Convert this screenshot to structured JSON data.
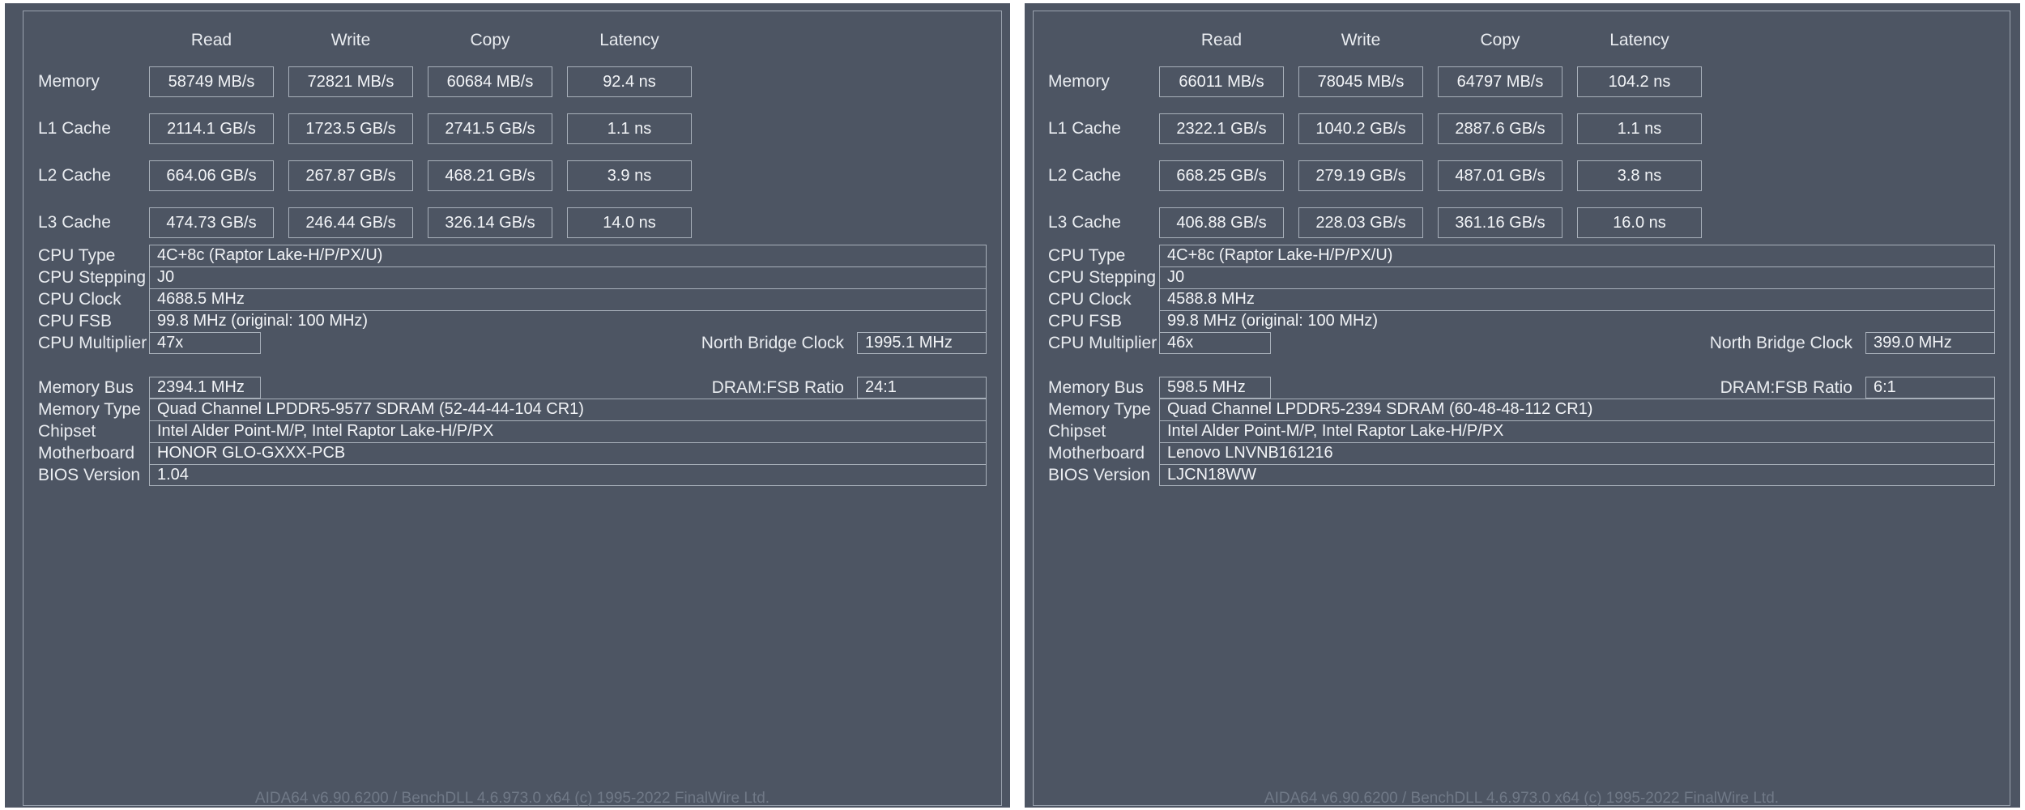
{
  "app": {
    "footer_text": "AIDA64 v6.90.6200 / BenchDLL 4.6.973.0 x64  (c) 1995-2022 FinalWire Ltd."
  },
  "colors": {
    "panel_bg": "#4d5563",
    "page_bg": "#ffffff",
    "border": "#a8b0ba",
    "text": "#f2f4f7",
    "label": "#e9ecf0",
    "footer_text": "#707987"
  },
  "columns": [
    "Read",
    "Write",
    "Copy",
    "Latency"
  ],
  "row_labels": [
    "Memory",
    "L1 Cache",
    "L2 Cache",
    "L3 Cache"
  ],
  "left_panel": {
    "bench": {
      "headers": {
        "read": "Read",
        "write": "Write",
        "copy": "Copy",
        "latency": "Latency"
      },
      "rows": [
        {
          "label": "Memory",
          "read": "58749 MB/s",
          "write": "72821 MB/s",
          "copy": "60684 MB/s",
          "latency": "92.4 ns"
        },
        {
          "label": "L1 Cache",
          "read": "2114.1 GB/s",
          "write": "1723.5 GB/s",
          "copy": "2741.5 GB/s",
          "latency": "1.1 ns"
        },
        {
          "label": "L2 Cache",
          "read": "664.06 GB/s",
          "write": "267.87 GB/s",
          "copy": "468.21 GB/s",
          "latency": "3.9 ns"
        },
        {
          "label": "L3 Cache",
          "read": "474.73 GB/s",
          "write": "246.44 GB/s",
          "copy": "326.14 GB/s",
          "latency": "14.0 ns"
        }
      ]
    },
    "cpu": {
      "type_label": "CPU Type",
      "type_value": "4C+8c   (Raptor Lake-H/P/PX/U)",
      "stepping_label": "CPU Stepping",
      "stepping_value": "J0",
      "clock_label": "CPU Clock",
      "clock_value": "4688.5 MHz",
      "fsb_label": "CPU FSB",
      "fsb_value": "99.8 MHz  (original: 100 MHz)",
      "multiplier_label": "CPU Multiplier",
      "multiplier_value": "47x",
      "nb_clock_label": "North Bridge Clock",
      "nb_clock_value": "1995.1 MHz"
    },
    "memory": {
      "bus_label": "Memory Bus",
      "bus_value": "2394.1 MHz",
      "ratio_label": "DRAM:FSB Ratio",
      "ratio_value": "24:1",
      "type_label": "Memory Type",
      "type_value": "Quad Channel LPDDR5-9577 SDRAM  (52-44-44-104 CR1)",
      "chipset_label": "Chipset",
      "chipset_value": "Intel Alder Point-M/P, Intel Raptor Lake-H/P/PX",
      "motherboard_label": "Motherboard",
      "motherboard_value": "HONOR GLO-GXXX-PCB",
      "bios_label": "BIOS Version",
      "bios_value": "1.04"
    },
    "footer": "AIDA64 v6.90.6200 / BenchDLL 4.6.973.0 x64  (c) 1995-2022 FinalWire Ltd."
  },
  "right_panel": {
    "bench": {
      "headers": {
        "read": "Read",
        "write": "Write",
        "copy": "Copy",
        "latency": "Latency"
      },
      "rows": [
        {
          "label": "Memory",
          "read": "66011 MB/s",
          "write": "78045 MB/s",
          "copy": "64797 MB/s",
          "latency": "104.2 ns"
        },
        {
          "label": "L1 Cache",
          "read": "2322.1 GB/s",
          "write": "1040.2 GB/s",
          "copy": "2887.6 GB/s",
          "latency": "1.1 ns"
        },
        {
          "label": "L2 Cache",
          "read": "668.25 GB/s",
          "write": "279.19 GB/s",
          "copy": "487.01 GB/s",
          "latency": "3.8 ns"
        },
        {
          "label": "L3 Cache",
          "read": "406.88 GB/s",
          "write": "228.03 GB/s",
          "copy": "361.16 GB/s",
          "latency": "16.0 ns"
        }
      ]
    },
    "cpu": {
      "type_label": "CPU Type",
      "type_value": "4C+8c   (Raptor Lake-H/P/PX/U)",
      "stepping_label": "CPU Stepping",
      "stepping_value": "J0",
      "clock_label": "CPU Clock",
      "clock_value": "4588.8 MHz",
      "fsb_label": "CPU FSB",
      "fsb_value": "99.8 MHz  (original: 100 MHz)",
      "multiplier_label": "CPU Multiplier",
      "multiplier_value": "46x",
      "nb_clock_label": "North Bridge Clock",
      "nb_clock_value": "399.0 MHz"
    },
    "memory": {
      "bus_label": "Memory Bus",
      "bus_value": "598.5 MHz",
      "ratio_label": "DRAM:FSB Ratio",
      "ratio_value": "6:1",
      "type_label": "Memory Type",
      "type_value": "Quad Channel LPDDR5-2394 SDRAM  (60-48-48-112 CR1)",
      "chipset_label": "Chipset",
      "chipset_value": "Intel Alder Point-M/P, Intel Raptor Lake-H/P/PX",
      "motherboard_label": "Motherboard",
      "motherboard_value": "Lenovo LNVNB161216",
      "bios_label": "BIOS Version",
      "bios_value": "LJCN18WW"
    },
    "footer": "AIDA64 v6.90.6200 / BenchDLL 4.6.973.0 x64  (c) 1995-2022 FinalWire Ltd."
  },
  "chart_data": {
    "type": "table",
    "title": "AIDA64 Cache & Memory Benchmark comparison",
    "categories": [
      "Memory",
      "L1 Cache",
      "L2 Cache",
      "L3 Cache"
    ],
    "metrics": [
      "Read",
      "Write",
      "Copy",
      "Latency"
    ],
    "systems": [
      {
        "name": "HONOR GLO-GXXX-PCB",
        "rows": [
          {
            "category": "Memory",
            "Read": "58749 MB/s",
            "Write": "72821 MB/s",
            "Copy": "60684 MB/s",
            "Latency": "92.4 ns"
          },
          {
            "category": "L1 Cache",
            "Read": "2114.1 GB/s",
            "Write": "1723.5 GB/s",
            "Copy": "2741.5 GB/s",
            "Latency": "1.1 ns"
          },
          {
            "category": "L2 Cache",
            "Read": "664.06 GB/s",
            "Write": "267.87 GB/s",
            "Copy": "468.21 GB/s",
            "Latency": "3.9 ns"
          },
          {
            "category": "L3 Cache",
            "Read": "474.73 GB/s",
            "Write": "246.44 GB/s",
            "Copy": "326.14 GB/s",
            "Latency": "14.0 ns"
          }
        ]
      },
      {
        "name": "Lenovo LNVNB161216",
        "rows": [
          {
            "category": "Memory",
            "Read": "66011 MB/s",
            "Write": "78045 MB/s",
            "Copy": "64797 MB/s",
            "Latency": "104.2 ns"
          },
          {
            "category": "L1 Cache",
            "Read": "2322.1 GB/s",
            "Write": "1040.2 GB/s",
            "Copy": "2887.6 GB/s",
            "Latency": "1.1 ns"
          },
          {
            "category": "L2 Cache",
            "Read": "668.25 GB/s",
            "Write": "279.19 GB/s",
            "Copy": "487.01 GB/s",
            "Latency": "3.8 ns"
          },
          {
            "category": "L3 Cache",
            "Read": "406.88 GB/s",
            "Write": "228.03 GB/s",
            "Copy": "361.16 GB/s",
            "Latency": "16.0 ns"
          }
        ]
      }
    ]
  }
}
